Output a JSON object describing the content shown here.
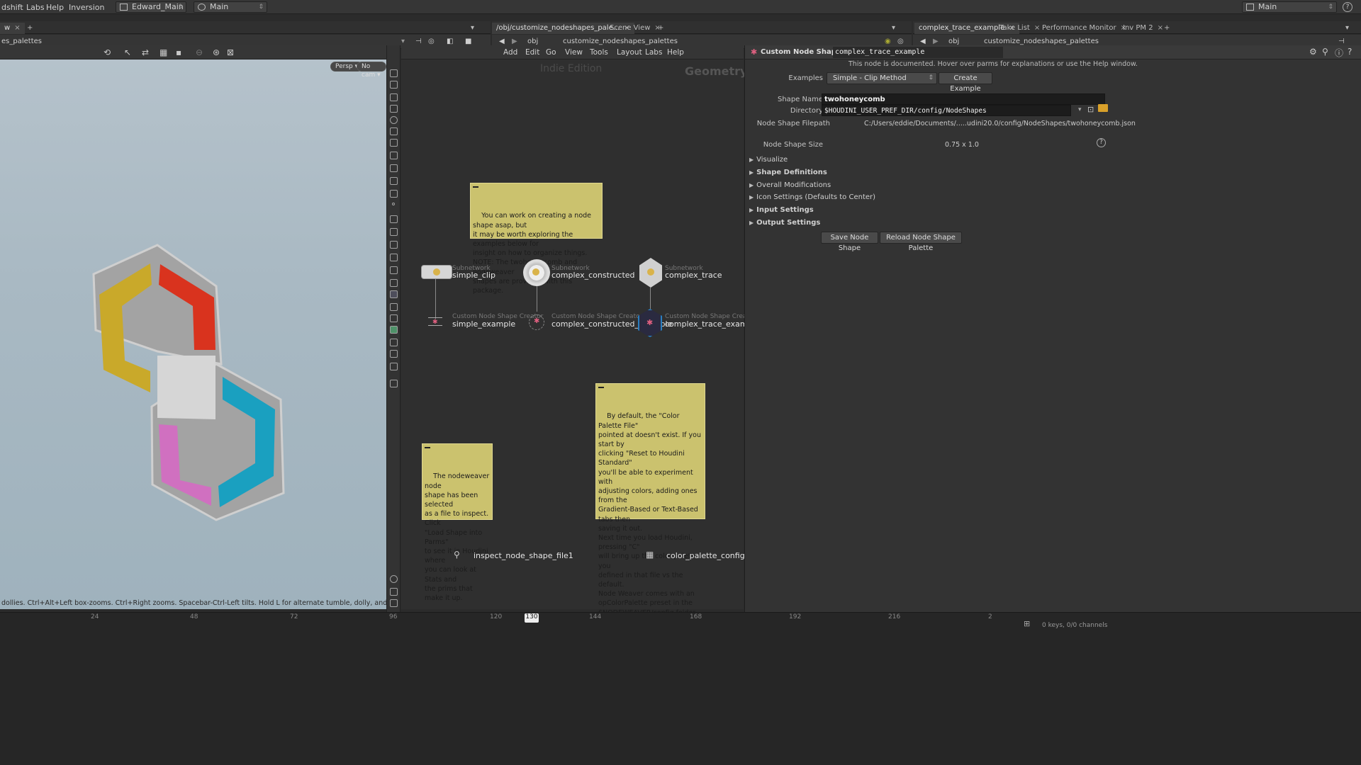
{
  "menubar": {
    "items": [
      "dshift",
      "Labs",
      "Help",
      "Inversion"
    ],
    "desktop": "Edward_Main",
    "context": "Main",
    "right_context": "Main"
  },
  "left_pane": {
    "tab": "w",
    "path": "es_palettes",
    "persp_btn": "Persp ▾",
    "cam_btn": "No cam ▾",
    "hint": "dollies. Ctrl+Alt+Left box-zooms. Ctrl+Right zooms. Spacebar-Ctrl-Left tilts. Hold L for alternate tumble, dolly, and zoom. M or Alt+M for First Person Navigation."
  },
  "network_pane": {
    "tabs": [
      "/obj/customize_nodeshapes_pale...",
      "Scene View"
    ],
    "path_root": "obj",
    "path_node": "customize_nodeshapes_palettes",
    "menu": [
      "Add",
      "Edit",
      "Go",
      "View",
      "Tools",
      "Layout",
      "Labs",
      "Help"
    ],
    "watermark_edition": "Indie Edition",
    "watermark_context": "Geometry",
    "sticky1": "You can work on creating a node shape asap, but\nit may be worth exploring the examples below for\ninsight on how to organize things.\nNOTE: The twohoneycomb and nodeweaver\nshapes are provided with this package.",
    "sticky2": "The nodeweaver node\nshape has been selected\nas a file to inspect. Click\n\"Load Shape into Parms\"\nto see it in Houdini where\nyou can look at Stats and\nthe prims that make it up.",
    "sticky3": "By default, the \"Color Palette File\"\npointed at doesn't exist. If you start by\nclicking \"Reset to Houdini Standard\"\nyou'll be able to experiment with\nadjusting colors, adding ones from the\nGradient-Based or Text-Based tabs then\nsaving it out.\nNext time you load Houdini, pressing \"C\"\nwill bring up the color palette you\ndefined in that file vs the default.\nNode Weaver comes with an\nopColorPalette preset in the\n$NODEWEAVER/config folder that you\nneed to rename to opColorPalette.def in\norder to use if you'd like.",
    "nodes": [
      {
        "type": "Subnetwork",
        "name": "simple_clip"
      },
      {
        "type": "Subnetwork",
        "name": "complex_constructed"
      },
      {
        "type": "Subnetwork",
        "name": "complex_trace"
      },
      {
        "type": "Custom Node Shape Creator",
        "name": "simple_example"
      },
      {
        "type": "Custom Node Shape Creator",
        "name": "complex_constructed_example"
      },
      {
        "type": "Custom Node Shape Creator",
        "name": "complex_trace_example"
      },
      {
        "type": "",
        "name": "inspect_node_shape_file1"
      },
      {
        "type": "",
        "name": "color_palette_configurator"
      }
    ]
  },
  "param_pane": {
    "tabs": [
      "complex_trace_example",
      "Take List",
      "Performance Monitor",
      "Inv PM 2"
    ],
    "path_root": "obj",
    "path_node": "customize_nodeshapes_palettes",
    "node_type": "Custom Node Shape Creator",
    "node_name": "complex_trace_example",
    "doc_note": "This node is documented. Hover over parms for explanations or use the Help window.",
    "examples_label": "Examples",
    "examples_value": "Simple - Clip Method",
    "create_example_btn": "Create Example",
    "shape_name_label": "Shape Name",
    "shape_name_value": "twohoneycomb",
    "directory_label": "Directory",
    "directory_value": "$HOUDINI_USER_PREF_DIR/config/NodeShapes",
    "filepath_label": "Node Shape Filepath",
    "filepath_value": "C:/Users/eddie/Documents/.....udini20.0/config/NodeShapes/twohoneycomb.json",
    "size_label": "Node Shape Size",
    "size_value": "0.75 x 1.0",
    "folders": [
      "Visualize",
      "Shape Definitions",
      "Overall Modifications",
      "Icon Settings (Defaults to Center)",
      "Input Settings",
      "Output Settings"
    ],
    "save_btn": "Save Node Shape",
    "reload_btn": "Reload Node Shape Palette"
  },
  "timeline": {
    "ticks": [
      "24",
      "48",
      "72",
      "96",
      "120",
      "144",
      "168",
      "192",
      "216",
      "2"
    ],
    "current_frame": "130",
    "status": "0 keys, 0/0 channels"
  },
  "colors": {
    "hex_yellow": "#c9a92a",
    "hex_red": "#d9331e",
    "hex_cyan": "#1aa0c0",
    "hex_pink": "#d070c0",
    "sticky": "#cbc26e"
  }
}
